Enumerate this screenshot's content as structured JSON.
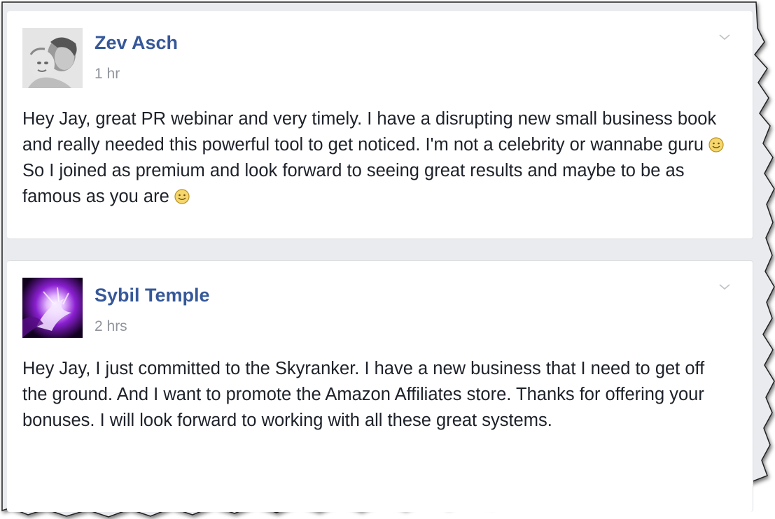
{
  "feed": {
    "posts": [
      {
        "author": "Zev Asch",
        "time": "1 hr",
        "avatar_icon": "profile-photo-icon",
        "body": [
          "Hey Jay, great PR webinar and very timely. I have a disrupting new small business book and really needed this powerful tool to get noticed. I'm not a celebrity or wannabe guru ",
          " So I joined as premium and look forward to seeing great results and maybe to be as famous as you are ",
          ""
        ]
      },
      {
        "author": "Sybil Temple",
        "time": "2 hrs",
        "avatar_icon": "profile-photo-icon",
        "body": "Hey Jay, I just committed to the Skyranker. I have a new business that I need to get off the ground. And I want to promote the Amazon Affiliates store. Thanks for offering your bonuses. I will look forward to working with all these great systems."
      }
    ]
  },
  "colors": {
    "author_link": "#365899",
    "timestamp": "#90949c",
    "body_text": "#1d2129",
    "card_border": "#dddfe2",
    "feed_gap": "#e9ebee",
    "emoji_fill": "#f5d76e"
  }
}
